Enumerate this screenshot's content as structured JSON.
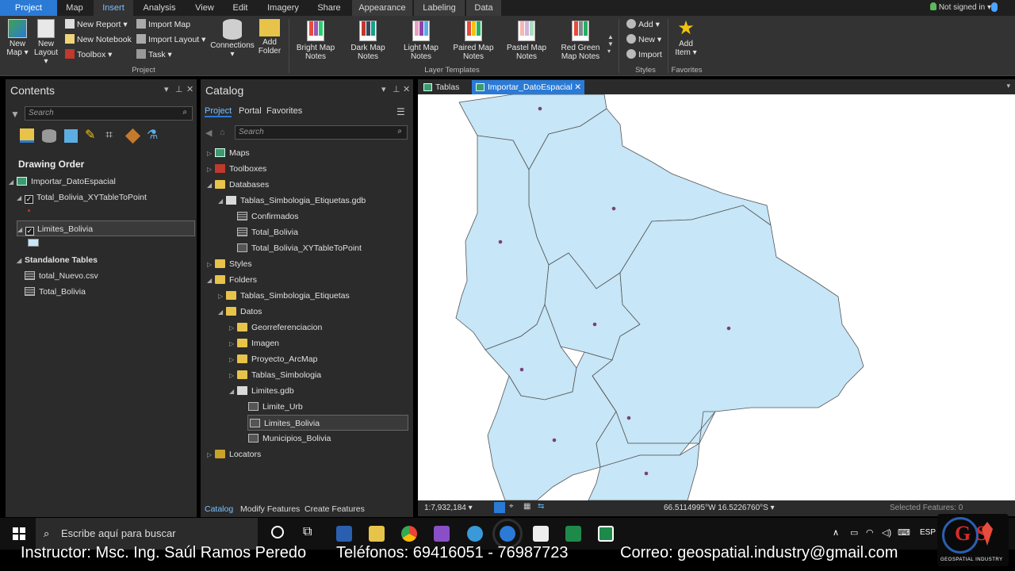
{
  "ribbon_tabs": [
    "Project",
    "Map",
    "Insert",
    "Analysis",
    "View",
    "Edit",
    "Imagery",
    "Share",
    "Appearance",
    "Labeling",
    "Data"
  ],
  "user_status": "Not signed in",
  "ribbon": {
    "project": {
      "new_map": "New Map",
      "new_layout": "New Layout",
      "new_report": "New Report",
      "new_notebook": "New Notebook",
      "toolbox": "Toolbox",
      "import_map": "Import Map",
      "import_layout": "Import Layout",
      "task": "Task",
      "connections": "Connections",
      "add_folder": "Add Folder",
      "group_label": "Project"
    },
    "layer_templates": {
      "items": [
        "Bright Map Notes",
        "Dark Map Notes",
        "Light Map Notes",
        "Paired Map Notes",
        "Pastel Map Notes",
        "Red Green Map Notes"
      ],
      "group_label": "Layer Templates"
    },
    "styles": {
      "add": "Add",
      "new": "New",
      "import": "Import",
      "group_label": "Styles"
    },
    "favorites": {
      "add_item": "Add Item",
      "group_label": "Favorites"
    }
  },
  "contents": {
    "title": "Contents",
    "search_placeholder": "Search",
    "drawing_order": "Drawing Order",
    "map_name": "Importar_DatoEspacial",
    "layers": [
      "Total_Bolivia_XYTableToPoint",
      "Limites_Bolivia"
    ],
    "standalone_tables_label": "Standalone Tables",
    "tables": [
      "total_Nuevo.csv",
      "Total_Bolivia"
    ]
  },
  "catalog": {
    "title": "Catalog",
    "tabs": [
      "Project",
      "Portal",
      "Favorites"
    ],
    "search_placeholder": "Search",
    "tree": {
      "maps": "Maps",
      "toolboxes": "Toolboxes",
      "databases": "Databases",
      "gdb_name": "Tablas_Simbologia_Etiquetas.gdb",
      "gdb_items": [
        "Confirmados",
        "Total_Bolivia",
        "Total_Bolivia_XYTableToPoint"
      ],
      "styles": "Styles",
      "folders": "Folders",
      "folder1": "Tablas_Simbologia_Etiquetas",
      "datos": "Datos",
      "datos_items": [
        "Georreferenciacion",
        "Imagen",
        "Proyecto_ArcMap",
        "Tablas_Simbologia"
      ],
      "limites_gdb": "Limites.gdb",
      "limites_items": [
        "Limite_Urb",
        "Limites_Bolivia",
        "Municipios_Bolivia"
      ],
      "locators": "Locators"
    },
    "bottom_tabs": [
      "Catalog",
      "Modify Features",
      "Create Features"
    ]
  },
  "map_view": {
    "tabs": [
      "Tablas",
      "Importar_DatoEspacial"
    ],
    "scale": "1:7,932,184",
    "coordinates": "66.5114995°W 16.5226760°S",
    "selected_features": "Selected Features: 0",
    "fill_color": "#c7e6f7",
    "point_color": "#7a3f7a"
  },
  "taskbar": {
    "search_text": "Escribe aquí para buscar",
    "lang": "ESP"
  },
  "caption": {
    "instructor": "Instructor: Msc. Ing. Saúl Ramos Peredo",
    "phones": "Teléfonos: 69416051 - 76987723",
    "email": "Correo: geospatial.industry@gmail.com"
  },
  "logo_text": "GEOSPATIAL INDUSTRY"
}
